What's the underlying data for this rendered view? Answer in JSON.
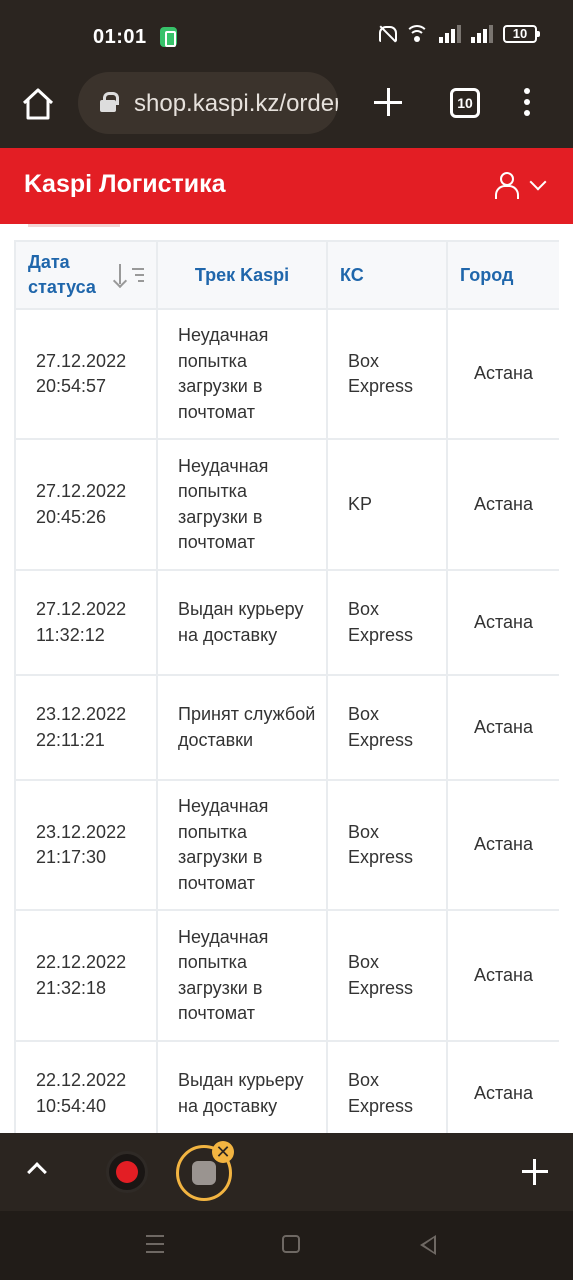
{
  "status_bar": {
    "time": "01:01",
    "battery": "10"
  },
  "browser": {
    "url": "shop.kaspi.kz/orders",
    "tab_count": "10"
  },
  "header": {
    "title": "Kaspi Логистика"
  },
  "table": {
    "headers": {
      "date": "Дата статуса",
      "track": "Трек Kaspi",
      "ks": "КС",
      "city": "Город"
    },
    "rows": [
      {
        "date": "27.12.2022 20:54:57",
        "track": "Неудачная попытка загрузки в почтомат",
        "ks": "Box Express",
        "city": "Астана"
      },
      {
        "date": "27.12.2022 20:45:26",
        "track": "Неудачная попытка загрузки в почтомат",
        "ks": "KP",
        "city": "Астана"
      },
      {
        "date": "27.12.2022 11:32:12",
        "track": "Выдан курьеру на доставку",
        "ks": "Box Express",
        "city": "Астана"
      },
      {
        "date": "23.12.2022 22:11:21",
        "track": "Принят службой доставки",
        "ks": "Box Express",
        "city": "Астана"
      },
      {
        "date": "23.12.2022 21:17:30",
        "track": "Неудачная попытка загрузки в почтомат",
        "ks": "Box Express",
        "city": "Астана"
      },
      {
        "date": "22.12.2022 21:32:18",
        "track": "Неудачная попытка загрузки в почтомат",
        "ks": "Box Express",
        "city": "Астана"
      },
      {
        "date": "22.12.2022 10:54:40",
        "track": "Выдан курьеру на доставку",
        "ks": "Box Express",
        "city": "Астана"
      }
    ]
  },
  "bottom_tabs": {
    "close_label": "✕"
  },
  "colors": {
    "brand_red": "#e31e24",
    "header_link": "#1f66ab",
    "chrome_dark": "#2b2520"
  }
}
